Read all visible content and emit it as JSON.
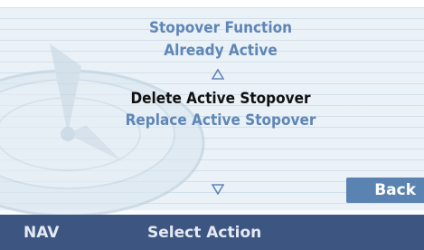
{
  "menu": {
    "header_line1": "Stopover Function",
    "header_line2": "Already Active",
    "items": [
      {
        "label": "Delete Active Stopover",
        "selected": true
      },
      {
        "label": "Replace Active Stopover",
        "selected": false
      }
    ]
  },
  "buttons": {
    "back_label": "Back"
  },
  "status_bar": {
    "mode_label": "NAV",
    "title": "Select Action"
  },
  "icons": {
    "scroll_up": "up-triangle-icon",
    "scroll_down": "down-triangle-icon",
    "background": "compass-icon"
  },
  "colors": {
    "menu_text": "#5f86b6",
    "selected_text": "#111111",
    "background": "#eaf2f8",
    "bar": "#3d5581",
    "button": "#5b83b2"
  }
}
